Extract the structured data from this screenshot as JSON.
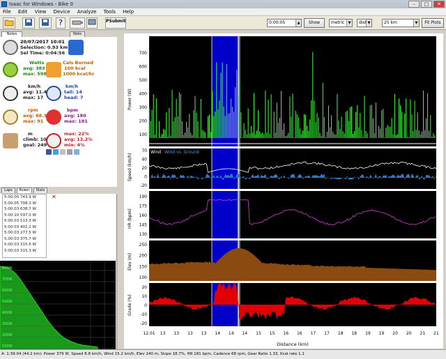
{
  "window": {
    "title": "Isaac for Windows - Bike 0",
    "min": "–",
    "max": "□",
    "close": "✕"
  },
  "menu": [
    "File",
    "Edit",
    "View",
    "Device",
    "Analyze",
    "Tools",
    "Help"
  ],
  "toolbar": {
    "time_value": "0:00:05",
    "show_label": "Show",
    "units_value": "metric",
    "x_value": "dist",
    "range_value": "25 km",
    "fit_label": "Fit Plots",
    "upload_label": "PSubmit"
  },
  "left_tabs": [
    "Notes",
    "Note"
  ],
  "summary": {
    "date": "20/07/2017 10:01",
    "selection": "Selection: 0.93 km",
    "sel_time": "Sel Time: 0:04:56",
    "watts_title": "Watts",
    "watts_avg": "avg: 383",
    "watts_max": "max: 598",
    "cals_title": "Cals Burned",
    "cals_value": "100 kcal",
    "cals_rate": "1000 kcal/hr",
    "speed_title": "km/h",
    "speed_avg": "avg: 11.4",
    "speed_max": "max: 17",
    "kmh_title": "km/h",
    "kmh_tail": "tail: 14",
    "kmh_head": "head: 7",
    "rpm_title": "rpm",
    "rpm_avg": "avg: 68.3",
    "rpm_max": "max: 91",
    "bpm_title": "bpm",
    "bpm_avg": "avg: 180",
    "bpm_max": "max: 181",
    "elev_title": "m",
    "elev_climb": "climb: 107",
    "elev_goal": "goal: 249",
    "grade_max": "max: 22%",
    "grade_avg": "avg: 13.2%",
    "grade_min": "min: 4%"
  },
  "lower_tabs": [
    "Laps",
    "Power",
    "Stats"
  ],
  "power_list": [
    "5:00:00 743.9 W",
    "5:00:05 708.1 W",
    "5:00:03 638.7 W",
    "5:00:10 597.0 W",
    "5:00:03 513.3 W",
    "5:00:03 402.2 W",
    "5:00:03 277.5 W",
    "5:00:03 375.7 W",
    "5:00:03 315.6 W",
    "5:00:03 315.3 W"
  ],
  "hist_ticks": [
    "800W",
    "700W",
    "600W",
    "500W",
    "400W",
    "300W",
    "200W",
    "100W",
    "0W",
    "900W",
    "200W",
    "100W"
  ],
  "legend": {
    "wind": "Wind",
    "wind_series": "Wind vs. Ground"
  },
  "plot": {
    "x_ticks": [
      "12.01",
      "13",
      "13",
      "13",
      "13",
      "14",
      "14",
      "14",
      "15",
      "15",
      "16",
      "16",
      "17",
      "17",
      "18",
      "18",
      "19",
      "19",
      "20",
      "20",
      "21",
      "21"
    ],
    "x_label": "Distance (km)",
    "power_ylabel": "Power (W)",
    "power_ticks": [
      "700",
      "600",
      "500",
      "400",
      "300",
      "200",
      "100"
    ],
    "speed_ylabel": "Speed (km/h)",
    "speed_ticks": [
      "70",
      "40",
      "20",
      "0",
      "-20"
    ],
    "hr_ylabel": "HR (bpm)",
    "hr_ticks": [
      "190",
      "175",
      "160",
      "145",
      "130"
    ],
    "elev_ylabel": "Elev (m)",
    "elev_ticks": [
      "250",
      "200",
      "150",
      "100"
    ],
    "grade_ylabel": "Grade (%)",
    "grade_ticks": [
      "20",
      "10",
      "0",
      "-10",
      "-20"
    ]
  },
  "status": "A: 1:39:04 (44.2 km): Power 379 W, Speed 8.8 km/h, Wind 15.2 km/h, Elev 240 m, Slope 18.7%, HR 181 bpm, Cadence 68 rpm, Gear Ratio 1.33, Kcal rate 1.1",
  "colors": {
    "power": "#3cff3c",
    "speed": "#2a7ac8",
    "wind": "#ffffff",
    "hr": "#d040d0",
    "elev": "#8a4a10",
    "grade": "#e00000",
    "selection": "#0000c8",
    "marker": "#ffff80"
  }
}
